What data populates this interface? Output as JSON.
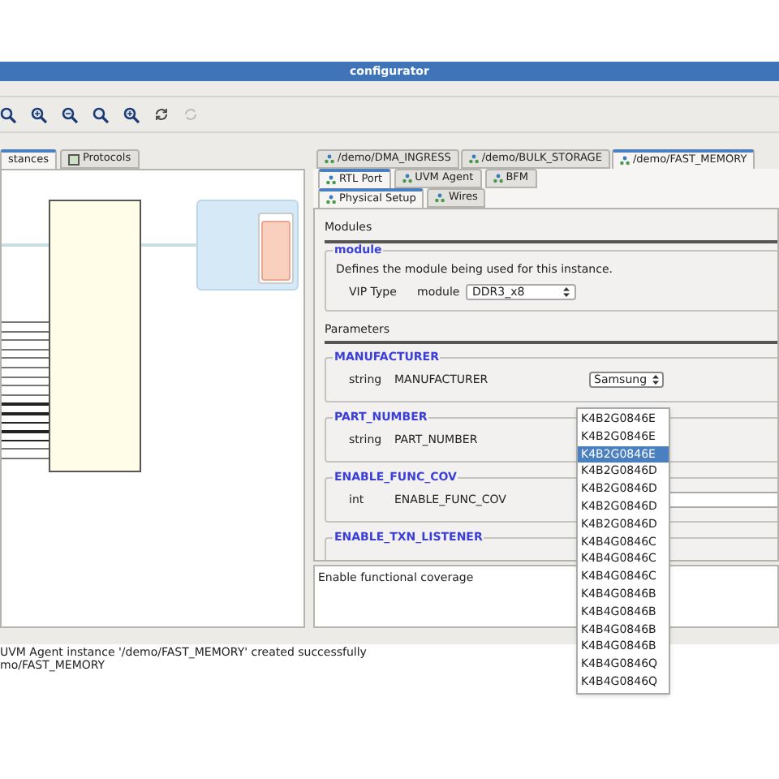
{
  "window": {
    "title": "configurator"
  },
  "left_tabs": [
    {
      "label": "stances",
      "selected": true
    },
    {
      "label": "Protocols",
      "selected": false
    }
  ],
  "instance_tabs": [
    {
      "label": "/demo/DMA_INGRESS",
      "selected": false
    },
    {
      "label": "/demo/BULK_STORAGE",
      "selected": false
    },
    {
      "label": "/demo/FAST_MEMORY",
      "selected": true
    }
  ],
  "sub_tabs": [
    {
      "label": "RTL Port",
      "selected": true
    },
    {
      "label": "UVM Agent",
      "selected": false
    },
    {
      "label": "BFM",
      "selected": false
    }
  ],
  "setup_tabs": [
    {
      "label": "Physical Setup",
      "selected": true
    },
    {
      "label": "Wires",
      "selected": false
    }
  ],
  "modules": {
    "heading": "Modules",
    "group": {
      "title": "module",
      "description": "Defines the module being used for this instance.",
      "label": "VIP Type",
      "type": "module",
      "value": "DDR3_x8"
    }
  },
  "parameters": {
    "heading": "Parameters",
    "groups": [
      {
        "title": "MANUFACTURER",
        "kind": "select",
        "type": "string",
        "name": "MANUFACTURER",
        "value": "Samsung"
      },
      {
        "title": "PART_NUMBER",
        "kind": "select",
        "type": "string",
        "name": "PART_NUMBER"
      },
      {
        "title": "ENABLE_FUNC_COV",
        "kind": "field",
        "type": "int",
        "name": "ENABLE_FUNC_COV"
      },
      {
        "title": "ENABLE_TXN_LISTENER",
        "kind": "title"
      }
    ]
  },
  "description": "Enable functional coverage",
  "dropdown": {
    "options": [
      {
        "label": "K4B2G0846E",
        "selected": false
      },
      {
        "label": "K4B2G0846E",
        "selected": false
      },
      {
        "label": "K4B2G0846E",
        "selected": true
      },
      {
        "label": "K4B2G0846D",
        "selected": false
      },
      {
        "label": "K4B2G0846D",
        "selected": false
      },
      {
        "label": "K4B2G0846D",
        "selected": false
      },
      {
        "label": "K4B2G0846D",
        "selected": false
      },
      {
        "label": "K4B4G0846C",
        "selected": false
      },
      {
        "label": "K4B4G0846C",
        "selected": false
      },
      {
        "label": "K4B4G0846C",
        "selected": false
      },
      {
        "label": "K4B4G0846B",
        "selected": false
      },
      {
        "label": "K4B4G0846B",
        "selected": false
      },
      {
        "label": "K4B4G0846B",
        "selected": false
      },
      {
        "label": "K4B4G0846B",
        "selected": false
      },
      {
        "label": "K4B4G0846Q",
        "selected": false
      },
      {
        "label": "K4B4G0846Q",
        "selected": false
      }
    ]
  },
  "log": [
    "UVM Agent instance '/demo/FAST_MEMORY' created successfully",
    "mo/FAST_MEMORY"
  ]
}
